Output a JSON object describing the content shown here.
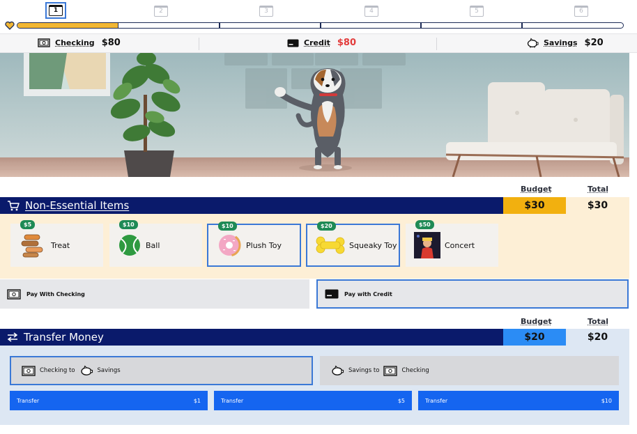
{
  "steps": [
    {
      "label": "1",
      "active": true
    },
    {
      "label": "2",
      "active": false
    },
    {
      "label": "3",
      "active": false
    },
    {
      "label": "4",
      "active": false
    },
    {
      "label": "5",
      "active": false
    },
    {
      "label": "6",
      "active": false
    }
  ],
  "progress": {
    "fraction": 0.167,
    "segments": 6
  },
  "balances": {
    "checking": {
      "label": "Checking",
      "amount": "$80"
    },
    "credit": {
      "label": "Credit",
      "amount": "$80",
      "color": "#e23b3b"
    },
    "savings": {
      "label": "Savings",
      "amount": "$20"
    }
  },
  "non_essential": {
    "budget_header": "Budget",
    "total_header": "Total",
    "title": "Non-Essential Items",
    "budget": "$30",
    "total": "$30",
    "budget_color": "#f2b00f",
    "items": [
      {
        "name": "Treat",
        "price": "$5",
        "icon": "treat-icon",
        "selected": false
      },
      {
        "name": "Ball",
        "price": "$10",
        "icon": "ball-icon",
        "selected": false
      },
      {
        "name": "Plush Toy",
        "price": "$10",
        "icon": "plush-toy-icon",
        "selected": true
      },
      {
        "name": "Squeaky Toy",
        "price": "$20",
        "icon": "squeaky-toy-icon",
        "selected": true
      },
      {
        "name": "Concert",
        "price": "$50",
        "icon": "concert-icon",
        "selected": false
      }
    ],
    "pay_checking": "Pay With Checking",
    "pay_credit": "Pay with Credit"
  },
  "transfer": {
    "budget_header": "Budget",
    "total_header": "Total",
    "title": "Transfer Money",
    "budget": "$20",
    "total": "$20",
    "budget_color": "#2b8cf5",
    "checking_to_savings": {
      "from": "Checking to",
      "to": "Savings"
    },
    "savings_to_checking": {
      "from": "Savings to",
      "to": "Checking"
    },
    "buttons": [
      {
        "label": "Transfer",
        "amount": "$1"
      },
      {
        "label": "Transfer",
        "amount": "$5"
      },
      {
        "label": "Transfer",
        "amount": "$10"
      }
    ]
  },
  "colors": {
    "navy": "#0a1a6b",
    "accent": "#3a78d6",
    "button_blue": "#1565f0",
    "progress_fill": "#f2b734"
  }
}
